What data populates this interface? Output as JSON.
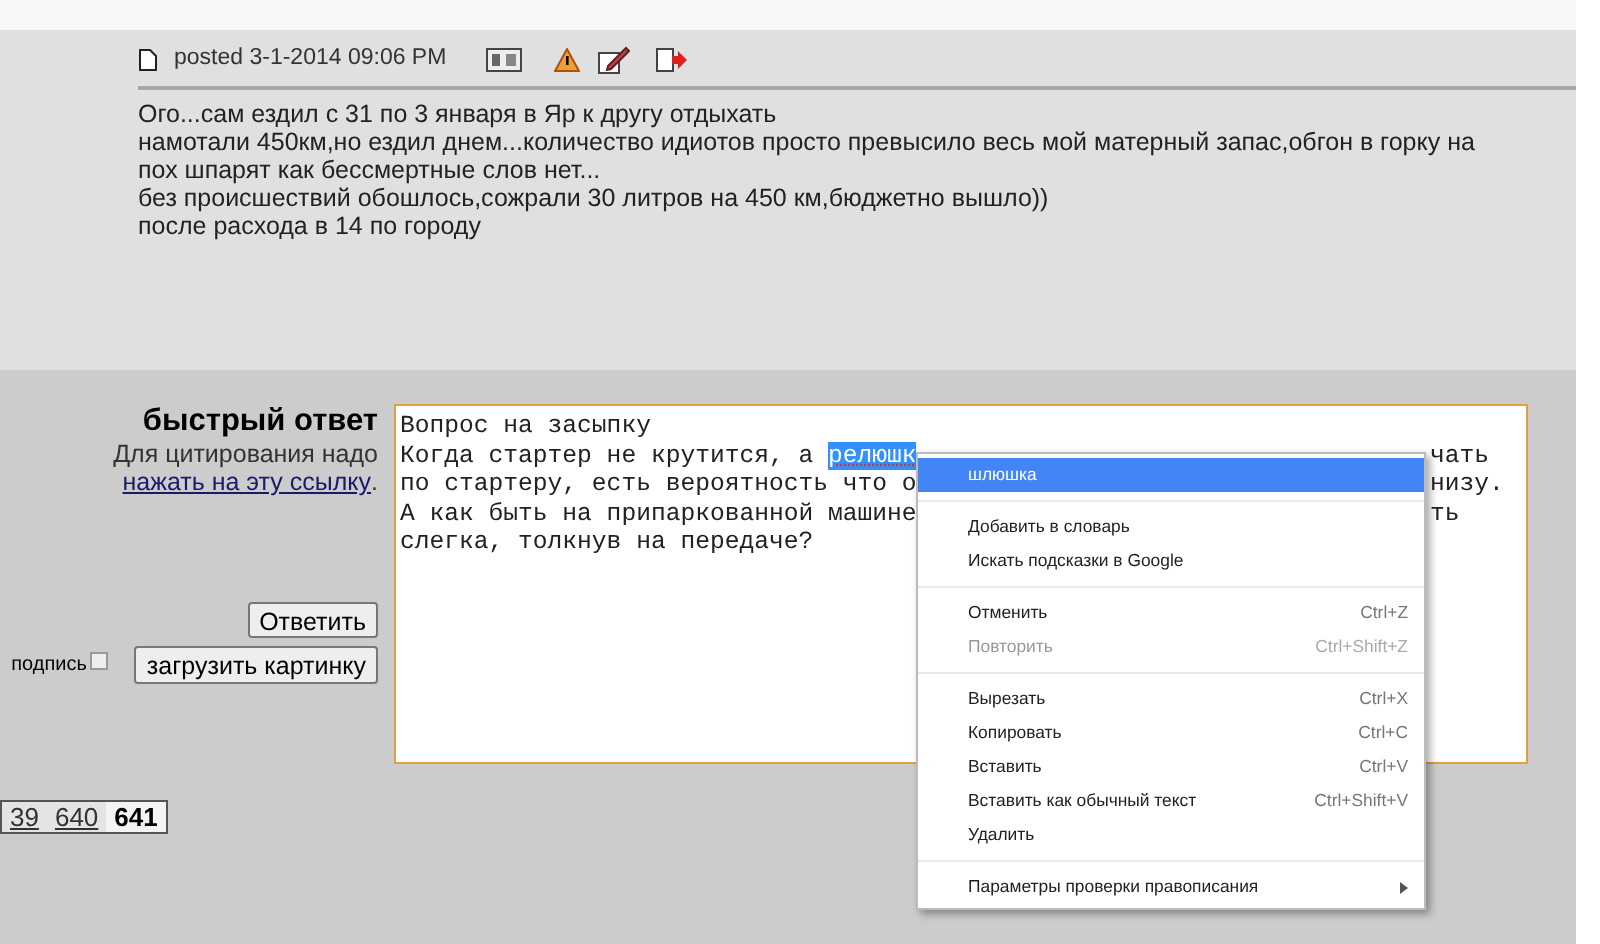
{
  "post": {
    "posted": "posted 3-1-2014 09:06 PM",
    "lines": [
      "Ого...сам ездил с 31 по 3 января в Яр к другу отдыхать",
      "намотали 450км,но ездил днем...количество идиотов просто превысило весь мой матерный запас,обгон в горку на",
      "пох шпарят как бессмертные слов нет...",
      "без происшествий обошлось,сожрали 30 литров на 450 км,бюджетно вышло))",
      "после расхода в 14 по городу"
    ]
  },
  "quick_reply": {
    "title": "быстрый ответ",
    "hint": "Для цитирования надо",
    "link": "нажать на эту ссылку",
    "link_end": ".",
    "reply_button": "Ответить",
    "signature": {
      "label": "подпись",
      "checked": false
    },
    "upload_button": "загрузить картинку"
  },
  "editor": {
    "lines": [
      {
        "left": "Вопрос на засыпку"
      },
      {
        "left": "Когда стартер не крутится, а ",
        "selected": "релюшк",
        "right": "чать"
      },
      {
        "left": "по стартеру, есть вероятность что о",
        "right": "низу."
      },
      {
        "left": "А как быть на припаркованной машине",
        "right": "ть"
      },
      {
        "left": "слегка, толкнув на передаче?"
      }
    ]
  },
  "context_menu": {
    "groups": [
      [
        {
          "label": "шлюшка",
          "selected": true,
          "disabled": false
        }
      ],
      [
        {
          "label": "Добавить в словарь",
          "selected": false,
          "disabled": false
        },
        {
          "label": "Искать подсказки в Google",
          "selected": false,
          "disabled": false
        }
      ],
      [
        {
          "label": "Отменить",
          "shortcut": "Ctrl+Z",
          "selected": false,
          "disabled": false
        },
        {
          "label": "Повторить",
          "shortcut": "Ctrl+Shift+Z",
          "selected": false,
          "disabled": true
        }
      ],
      [
        {
          "label": "Вырезать",
          "shortcut": "Ctrl+X",
          "selected": false,
          "disabled": false
        },
        {
          "label": "Копировать",
          "shortcut": "Ctrl+C",
          "selected": false,
          "disabled": false
        },
        {
          "label": "Вставить",
          "shortcut": "Ctrl+V",
          "selected": false,
          "disabled": false
        },
        {
          "label": "Вставить как обычный текст",
          "shortcut": "Ctrl+Shift+V",
          "selected": false,
          "disabled": false
        },
        {
          "label": "Удалить",
          "selected": false,
          "disabled": false
        }
      ],
      [
        {
          "label": "Параметры проверки правописания",
          "submenu": true,
          "selected": false,
          "disabled": false
        }
      ]
    ]
  },
  "pagination": [
    {
      "label": "39",
      "selected": false
    },
    {
      "label": "640",
      "selected": false
    },
    {
      "label": "641",
      "selected": true
    }
  ]
}
